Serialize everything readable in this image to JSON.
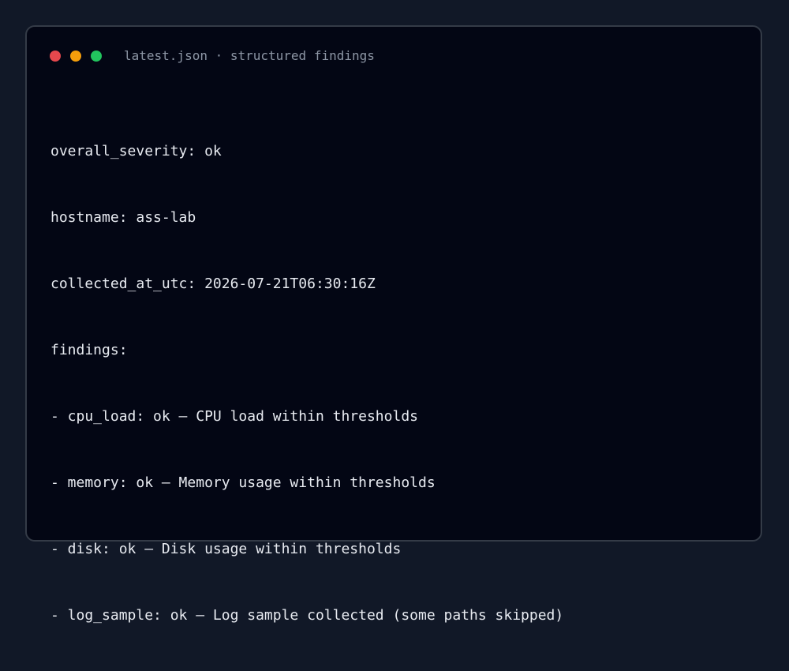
{
  "window": {
    "title": "latest.json · structured findings",
    "traffic_lights": {
      "close_color": "#e5484d",
      "minimize_color": "#f59e0b",
      "maximize_color": "#22c55e"
    }
  },
  "content": {
    "lines": [
      "overall_severity: ok",
      "hostname: ass-lab",
      "collected_at_utc: 2026-07-21T06:30:16Z",
      "findings:",
      "- cpu_load: ok — CPU load within thresholds",
      "- memory: ok — Memory usage within thresholds",
      "- disk: ok — Disk usage within thresholds",
      "- log_sample: ok — Log sample collected (some paths skipped)"
    ]
  }
}
